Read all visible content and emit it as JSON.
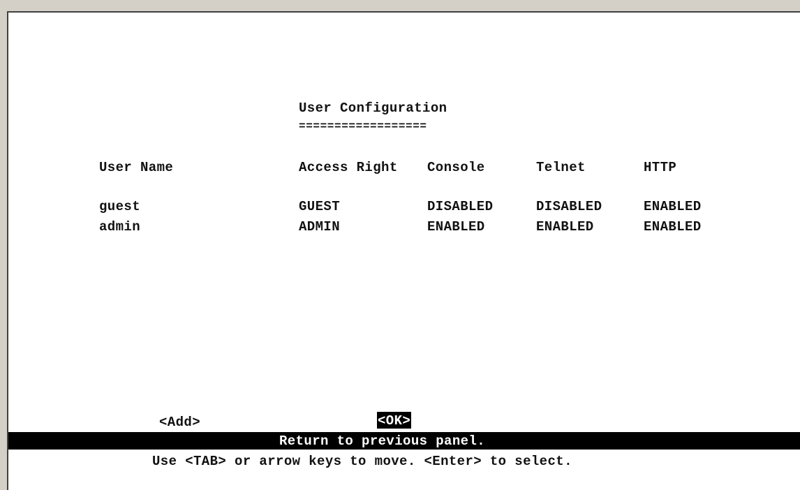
{
  "screen": {
    "title": "User Configuration",
    "title_underline": "=================="
  },
  "table": {
    "headers": [
      "User Name",
      "Access Right",
      "Console",
      "Telnet",
      "HTTP"
    ],
    "rows": [
      [
        "guest",
        "GUEST",
        "DISABLED",
        "DISABLED",
        "ENABLED"
      ],
      [
        "admin",
        "ADMIN",
        "ENABLED",
        "ENABLED",
        "ENABLED"
      ]
    ]
  },
  "actions": {
    "add_label": "<Add>",
    "ok_label": "<OK>"
  },
  "status": {
    "message": "Return to previous panel.",
    "help": "Use <TAB> or arrow keys to move. <Enter> to select."
  },
  "colors": {
    "background": "#ffffff",
    "text": "#111111",
    "highlight_bg": "#000000",
    "highlight_fg": "#ffffff",
    "window_chrome": "#d4d0c8"
  }
}
